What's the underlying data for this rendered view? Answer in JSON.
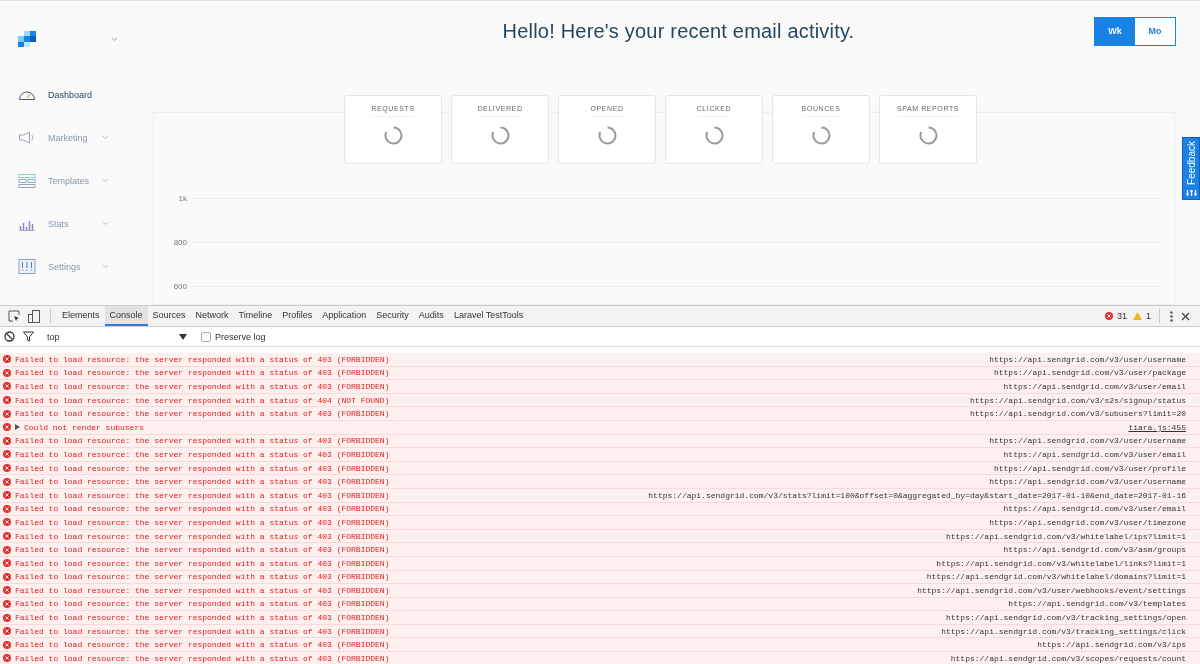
{
  "header": {
    "title": "Hello! Here's your recent email activity.",
    "period_toggle": [
      {
        "label": "Wk",
        "selected": true
      },
      {
        "label": "Mo",
        "selected": false
      }
    ]
  },
  "sidebar": {
    "items": [
      {
        "label": "Dashboard",
        "selected": true,
        "expandable": false
      },
      {
        "label": "Marketing",
        "selected": false,
        "expandable": true
      },
      {
        "label": "Templates",
        "selected": false,
        "expandable": true
      },
      {
        "label": "Stats",
        "selected": false,
        "expandable": true
      },
      {
        "label": "Settings",
        "selected": false,
        "expandable": true
      }
    ]
  },
  "stat_cards": [
    {
      "label": "REQUESTS",
      "loading": true
    },
    {
      "label": "DELIVERED",
      "loading": true
    },
    {
      "label": "OPENED",
      "loading": true
    },
    {
      "label": "CLICKED",
      "loading": true
    },
    {
      "label": "BOUNCES",
      "loading": true
    },
    {
      "label": "SPAM REPORTS",
      "loading": true
    }
  ],
  "chart_axis": {
    "y_labels": [
      "1k",
      "800",
      "600"
    ]
  },
  "feedback_tab": {
    "label": "Feedback"
  },
  "devtools": {
    "tabs": [
      {
        "label": "Elements",
        "selected": false
      },
      {
        "label": "Console",
        "selected": true
      },
      {
        "label": "Sources",
        "selected": false
      },
      {
        "label": "Network",
        "selected": false
      },
      {
        "label": "Timeline",
        "selected": false
      },
      {
        "label": "Profiles",
        "selected": false
      },
      {
        "label": "Application",
        "selected": false
      },
      {
        "label": "Security",
        "selected": false
      },
      {
        "label": "Audits",
        "selected": false
      },
      {
        "label": "Laravel TestTools",
        "selected": false
      }
    ],
    "error_count": "31",
    "warning_count": "1",
    "filter": {
      "context": "top",
      "preserve_log": {
        "label": "Preserve log",
        "checked": false
      }
    },
    "messages": [
      {
        "kind": "error",
        "text": "Failed to load resource: the server responded with a status of 403 (FORBIDDEN)",
        "source": "https://api.sendgrid.com/v3/user/username"
      },
      {
        "kind": "error",
        "text": "Failed to load resource: the server responded with a status of 403 (FORBIDDEN)",
        "source": "https://api.sendgrid.com/v3/user/package"
      },
      {
        "kind": "error",
        "text": "Failed to load resource: the server responded with a status of 403 (FORBIDDEN)",
        "source": "https://api.sendgrid.com/v3/user/email"
      },
      {
        "kind": "error",
        "text": "Failed to load resource: the server responded with a status of 404 (NOT FOUND)",
        "source": "https://api.sendgrid.com/v3/s2s/signup/status"
      },
      {
        "kind": "error",
        "text": "Failed to load resource: the server responded with a status of 403 (FORBIDDEN)",
        "source": "https://api.sendgrid.com/v3/subusers?limit=20"
      },
      {
        "kind": "group",
        "text": "Could not render subusers",
        "source": "tiara.js:455"
      },
      {
        "kind": "error",
        "text": "Failed to load resource: the server responded with a status of 403 (FORBIDDEN)",
        "source": "https://api.sendgrid.com/v3/user/username"
      },
      {
        "kind": "error",
        "text": "Failed to load resource: the server responded with a status of 403 (FORBIDDEN)",
        "source": "https://api.sendgrid.com/v3/user/email"
      },
      {
        "kind": "error",
        "text": "Failed to load resource: the server responded with a status of 403 (FORBIDDEN)",
        "source": "https://api.sendgrid.com/v3/user/profile"
      },
      {
        "kind": "error",
        "text": "Failed to load resource: the server responded with a status of 403 (FORBIDDEN)",
        "source": "https://api.sendgrid.com/v3/user/username"
      },
      {
        "kind": "error",
        "text": "Failed to load resource: the server responded with a status of 403 (FORBIDDEN)",
        "source": "https://api.sendgrid.com/v3/stats?limit=100&offset=0&aggregated_by=day&start_date=2017-01-10&end_date=2017-01-16"
      },
      {
        "kind": "error",
        "text": "Failed to load resource: the server responded with a status of 403 (FORBIDDEN)",
        "source": "https://api.sendgrid.com/v3/user/email"
      },
      {
        "kind": "error",
        "text": "Failed to load resource: the server responded with a status of 403 (FORBIDDEN)",
        "source": "https://api.sendgrid.com/v3/user/timezone"
      },
      {
        "kind": "error",
        "text": "Failed to load resource: the server responded with a status of 403 (FORBIDDEN)",
        "source": "https://api.sendgrid.com/v3/whitelabel/ips?limit=1"
      },
      {
        "kind": "error",
        "text": "Failed to load resource: the server responded with a status of 403 (FORBIDDEN)",
        "source": "https://api.sendgrid.com/v3/asm/groups"
      },
      {
        "kind": "error",
        "text": "Failed to load resource: the server responded with a status of 403 (FORBIDDEN)",
        "source": "https://api.sendgrid.com/v3/whitelabel/links?limit=1"
      },
      {
        "kind": "error",
        "text": "Failed to load resource: the server responded with a status of 403 (FORBIDDEN)",
        "source": "https://api.sendgrid.com/v3/whitelabel/domains?limit=1"
      },
      {
        "kind": "error",
        "text": "Failed to load resource: the server responded with a status of 403 (FORBIDDEN)",
        "source": "https://api.sendgrid.com/v3/user/webhooks/event/settings"
      },
      {
        "kind": "error",
        "text": "Failed to load resource: the server responded with a status of 403 (FORBIDDEN)",
        "source": "https://api.sendgrid.com/v3/templates"
      },
      {
        "kind": "error",
        "text": "Failed to load resource: the server responded with a status of 403 (FORBIDDEN)",
        "source": "https://api.sendgrid.com/v3/tracking_settings/open"
      },
      {
        "kind": "error",
        "text": "Failed to load resource: the server responded with a status of 403 (FORBIDDEN)",
        "source": "https://api.sendgrid.com/v3/tracking_settings/click"
      },
      {
        "kind": "error",
        "text": "Failed to load resource: the server responded with a status of 403 (FORBIDDEN)",
        "source": "https://api.sendgrid.com/v3/ips"
      },
      {
        "kind": "error",
        "text": "Failed to load resource: the server responded with a status of 403 (FORBIDDEN)",
        "source": "https://api.sendgrid.com/v3/scopes/requests/count"
      }
    ]
  }
}
